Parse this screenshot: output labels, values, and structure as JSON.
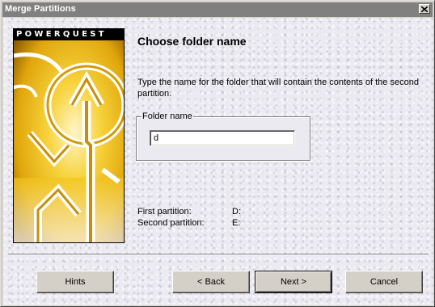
{
  "window": {
    "title": "Merge Partitions"
  },
  "banner": {
    "brand": "POWERQUEST"
  },
  "page": {
    "heading": "Choose folder name",
    "description": "Type the name for the folder that will contain the contents of the second partition."
  },
  "folder": {
    "group_label": "Folder name",
    "value": "d"
  },
  "partitions": {
    "first_label": "First partition:",
    "first_value": "D:",
    "second_label": "Second partition:",
    "second_value": "E:"
  },
  "buttons": {
    "hints": "Hints",
    "back": "< Back",
    "next": "Next >",
    "cancel": "Cancel"
  },
  "colors": {
    "titlebar_inactive": "#808080",
    "panel": "#ebeaf1",
    "banner_yellow": "#f2c318"
  },
  "icons": [
    "close-icon",
    "powerquest-arrow-logo"
  ]
}
